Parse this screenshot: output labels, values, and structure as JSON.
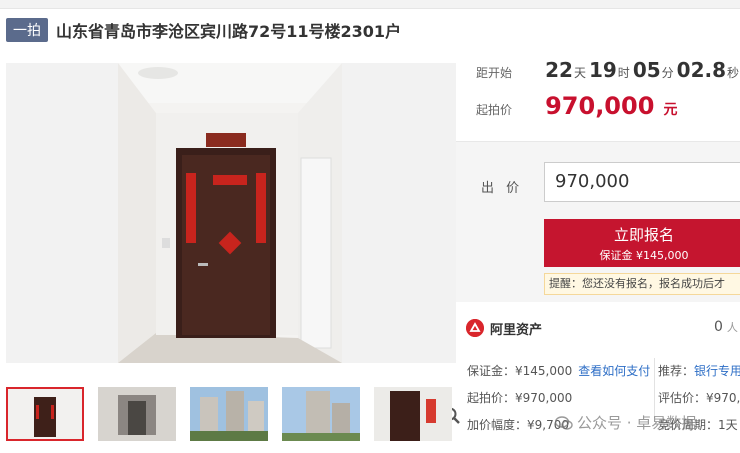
{
  "header": {
    "badge": "一拍",
    "title": "山东省青岛市李沧区宾川路72号11号楼2301户"
  },
  "countdown": {
    "label": "距开始",
    "days": "22",
    "days_unit": "天",
    "hours": "19",
    "hours_unit": "时",
    "minutes": "05",
    "minutes_unit": "分",
    "seconds": "02.8",
    "seconds_unit": "秒"
  },
  "starting_price": {
    "label": "起拍价",
    "value": "970,000",
    "unit": "元"
  },
  "bid": {
    "label": "出 价",
    "value": "970,000",
    "register_label": "立即报名",
    "deposit_label": "保证金 ¥145,000",
    "tip": "提醒：您还没有报名，报名成功后才"
  },
  "platform": {
    "name": "阿里资产",
    "count": "0",
    "count_unit": "人"
  },
  "details": {
    "deposit": "保证金：¥145,000",
    "how_to_pay": "查看如何支付",
    "recommend": "推荐：",
    "recommend_link": "银行专用",
    "start_price": "起拍价：¥970,000",
    "appraisal": "评估价：¥970,0",
    "increment": "加价幅度：¥9,700",
    "period": "竞价周期：1天"
  },
  "watermark": "公众号 · 卓易数据",
  "icons": {
    "zoom": "zoom-icon",
    "platform": "ali-asset-logo-icon",
    "watermark": "wechat-icon"
  },
  "colors": {
    "accent": "#c5152f",
    "badge": "#5b6b8c",
    "link": "#2d6ec6"
  }
}
